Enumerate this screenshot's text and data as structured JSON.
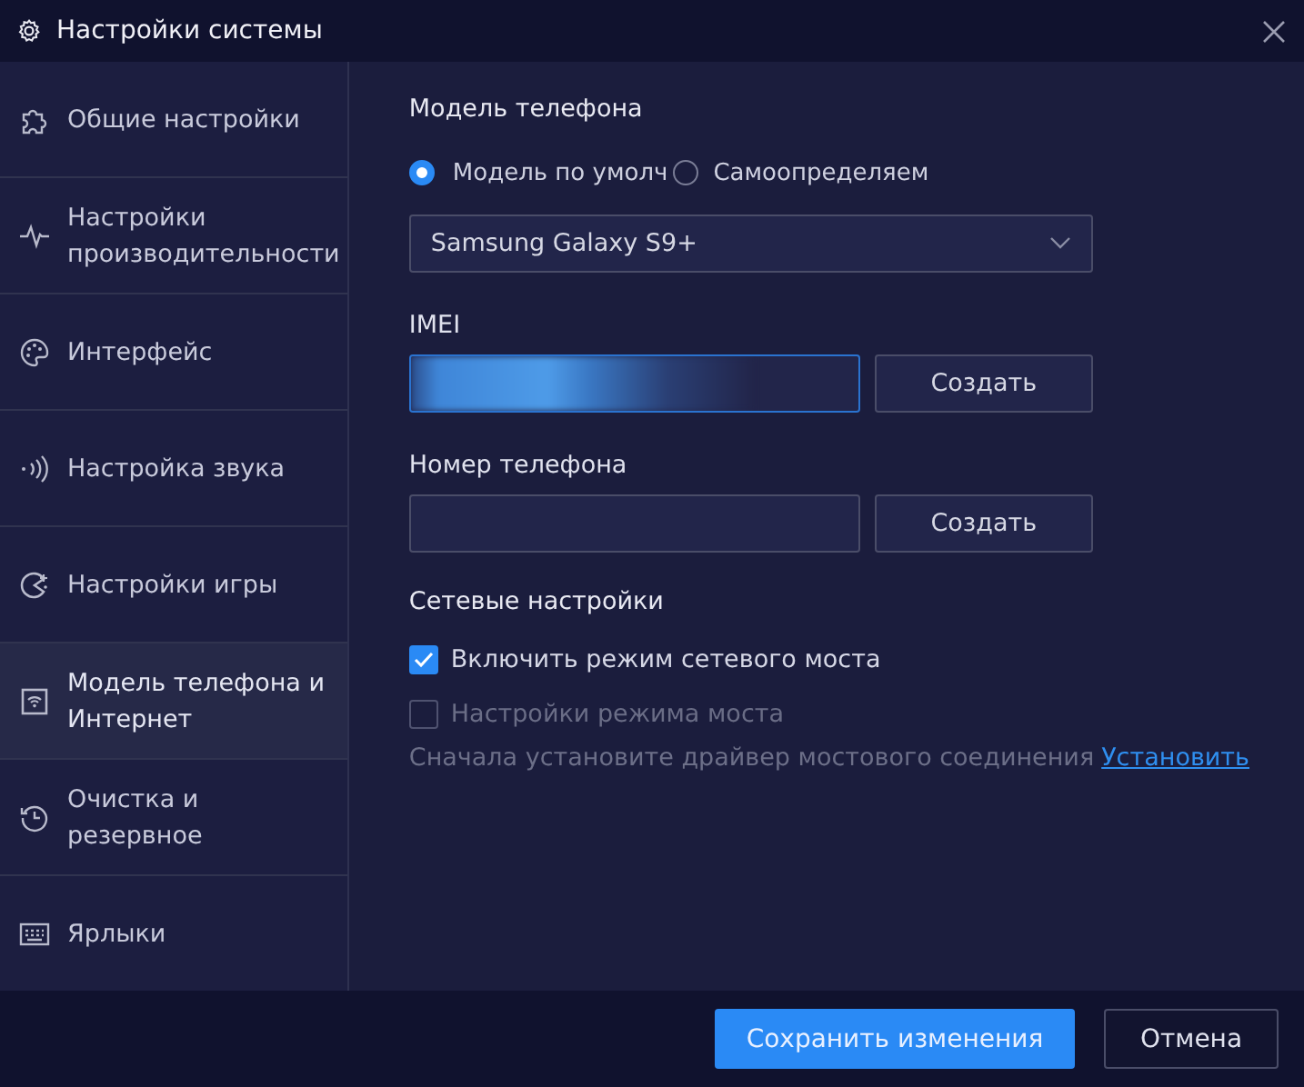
{
  "window": {
    "title": "Настройки системы"
  },
  "sidebar": {
    "items": [
      {
        "label": "Общие настройки",
        "selected": false
      },
      {
        "label": "Настройки производительности",
        "selected": false
      },
      {
        "label": "Интерфейс",
        "selected": false
      },
      {
        "label": "Настройка звука",
        "selected": false
      },
      {
        "label": "Настройки игры",
        "selected": false
      },
      {
        "label": "Модель телефона и Интернет",
        "selected": true
      },
      {
        "label": "Очистка и резервное",
        "selected": false
      },
      {
        "label": "Ярлыки",
        "selected": false
      }
    ]
  },
  "content": {
    "phone_model": {
      "heading": "Модель телефона",
      "radios": [
        {
          "label": "Модель по умолч",
          "selected": true
        },
        {
          "label": "Самоопределяем",
          "selected": false
        }
      ],
      "dropdown": {
        "value": "Samsung Galaxy S9+"
      }
    },
    "imei": {
      "label": "IMEI",
      "focused": true,
      "redacted": true,
      "button": "Создать"
    },
    "phone_number": {
      "label": "Номер телефона",
      "focused": false,
      "redacted": false,
      "button": "Создать"
    },
    "network": {
      "heading": "Сетевые настройки",
      "checkboxes": [
        {
          "label": "Включить режим сетевого моста",
          "checked": true,
          "disabled": false
        },
        {
          "label": "Настройки режима моста",
          "checked": false,
          "disabled": true
        }
      ],
      "note": "Сначала установите драйвер мостового соединения",
      "link": "Установить"
    }
  },
  "footer": {
    "buttons": [
      {
        "label": "Сохранить изменения",
        "kind": "primary"
      },
      {
        "label": "Отмена",
        "kind": "secondary"
      }
    ]
  }
}
